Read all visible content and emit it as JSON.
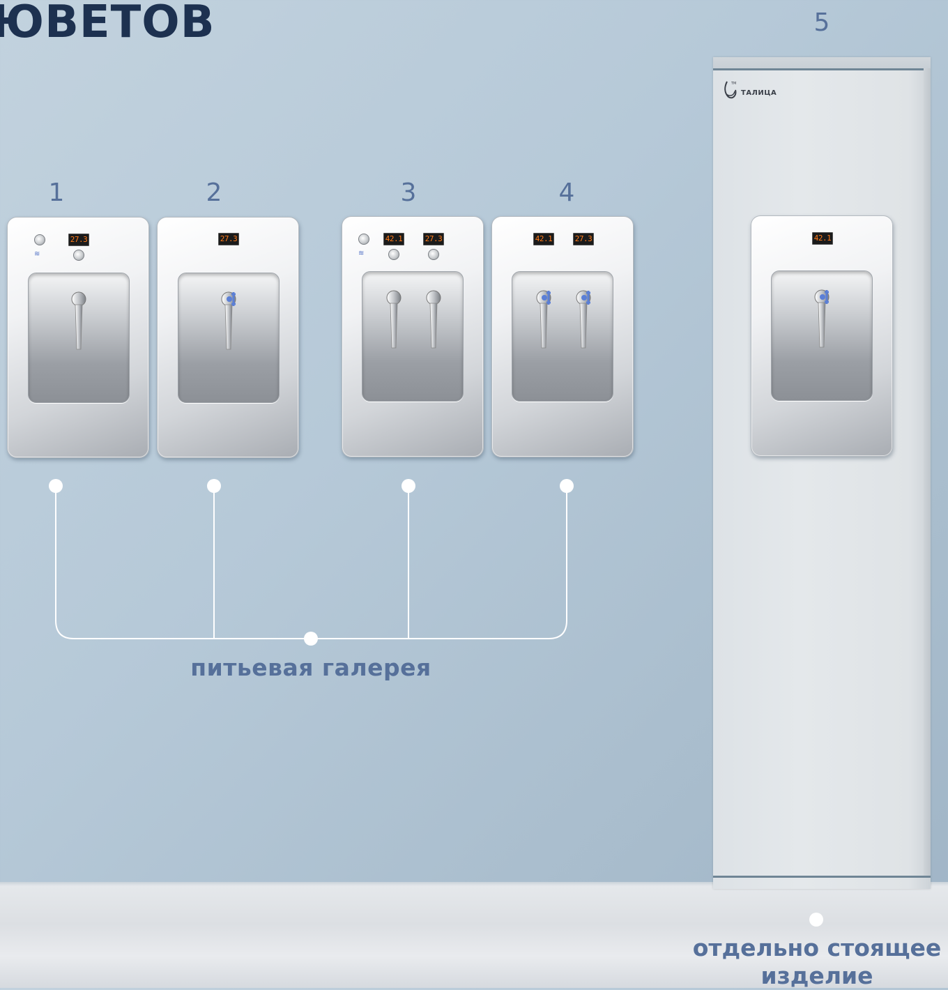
{
  "title": "ЮВЕТОВ",
  "units": [
    {
      "number": "1",
      "displays": [
        "27.3"
      ]
    },
    {
      "number": "2",
      "displays": [
        "27.3"
      ]
    },
    {
      "number": "3",
      "displays": [
        "42.1",
        "27.3"
      ]
    },
    {
      "number": "4",
      "displays": [
        "42.1",
        "27.3"
      ]
    },
    {
      "number": "5",
      "displays": [
        "42.1"
      ]
    }
  ],
  "brand": {
    "name": "ТАЛИЦА",
    "tm": "ТМ"
  },
  "labels": {
    "gallery": "питьевая галерея",
    "standalone": "отдельно стоящее изделие"
  },
  "colors": {
    "title": "#1d3150",
    "label": "#56709a",
    "display_text": "#ff7a1a",
    "accent_tap": "#5b7fd6"
  }
}
